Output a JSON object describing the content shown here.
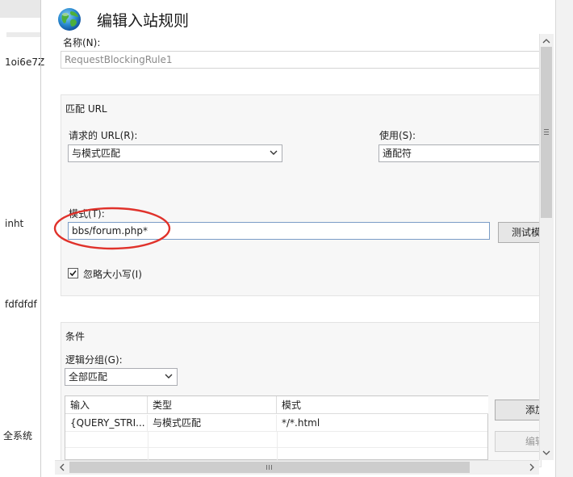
{
  "background_items": [
    "1oi6e7Z",
    "inht",
    "fdfdfdf",
    "全系统"
  ],
  "dialog": {
    "title": "编辑入站规则",
    "icon": "globe-icon",
    "name_label": "名称(N):",
    "name_value": "RequestBlockingRule1"
  },
  "match_url": {
    "group_title": "匹配 URL",
    "requested_url_label": "请求的 URL(R):",
    "requested_url_value": "与模式匹配",
    "using_label": "使用(S):",
    "using_value": "通配符",
    "pattern_label": "模式(T):",
    "pattern_value": "bbs/forum.php*",
    "test_pattern_button": "测试模",
    "ignore_case_label": "忽略大小写(I)",
    "ignore_case_checked": true
  },
  "conditions": {
    "group_title": "条件",
    "logical_grouping_label": "逻辑分组(G):",
    "logical_grouping_value": "全部匹配",
    "columns": [
      "输入",
      "类型",
      "模式"
    ],
    "rows": [
      [
        "{QUERY_STRI...",
        "与模式匹配",
        "*/*.html"
      ]
    ],
    "add_button": "添加",
    "edit_button": "编辑"
  },
  "colors": {
    "annotation_circle": "#e0322b",
    "group_bg": "#f7f7f7",
    "field_border": "#abadb3"
  }
}
